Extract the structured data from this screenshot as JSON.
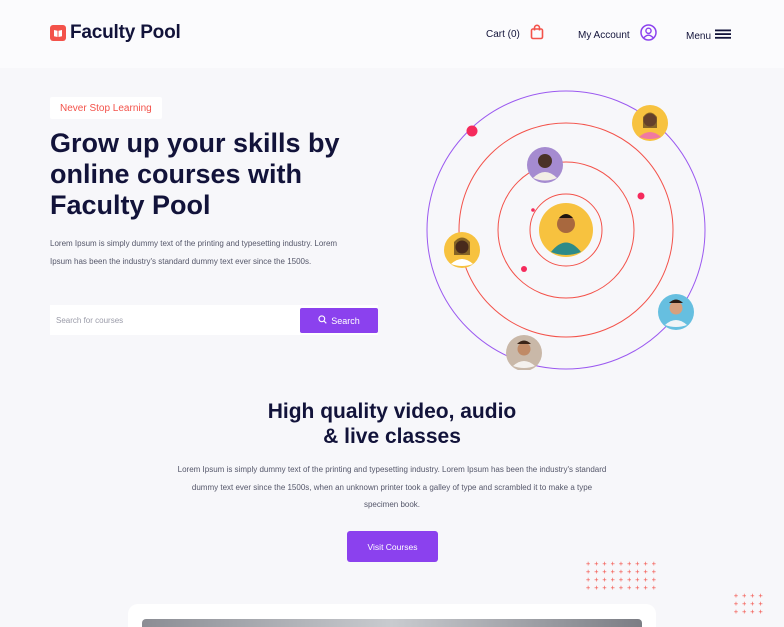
{
  "header": {
    "brand": "Faculty Pool",
    "cart_label": "Cart (0)",
    "account_label": "My Account",
    "menu_label": "Menu"
  },
  "hero": {
    "badge": "Never Stop Learning",
    "title": "Grow up your skills by online courses with Faculty Pool",
    "description": "Lorem Ipsum is simply dummy text of the printing and typesetting industry. Lorem Ipsum has been the industry's standard dummy text ever since the 1500s.",
    "search_placeholder": "Search for courses",
    "search_button": "Search"
  },
  "features": {
    "title_line1": "High quality video, audio",
    "title_line2": "& live classes",
    "description": "Lorem Ipsum is simply dummy text of the printing and typesetting industry. Lorem Ipsum has been the industry's standard dummy text ever since the 1500s, when an unknown printer took a galley of type and scrambled it to make a type specimen book.",
    "cta": "Visit Courses"
  },
  "colors": {
    "accent": "#8b41ee",
    "brand_red": "#f3524a",
    "heading": "#12133a",
    "avatar_yellow": "#f7c23f",
    "avatar_purple": "#a58bd0",
    "avatar_teal": "#66bfe0",
    "avatar_beige": "#c9b8a8"
  },
  "icons": {
    "logo": "book-icon",
    "cart": "shopping-bag-icon",
    "account": "user-circle-icon",
    "menu": "hamburger-icon",
    "search": "search-icon"
  }
}
